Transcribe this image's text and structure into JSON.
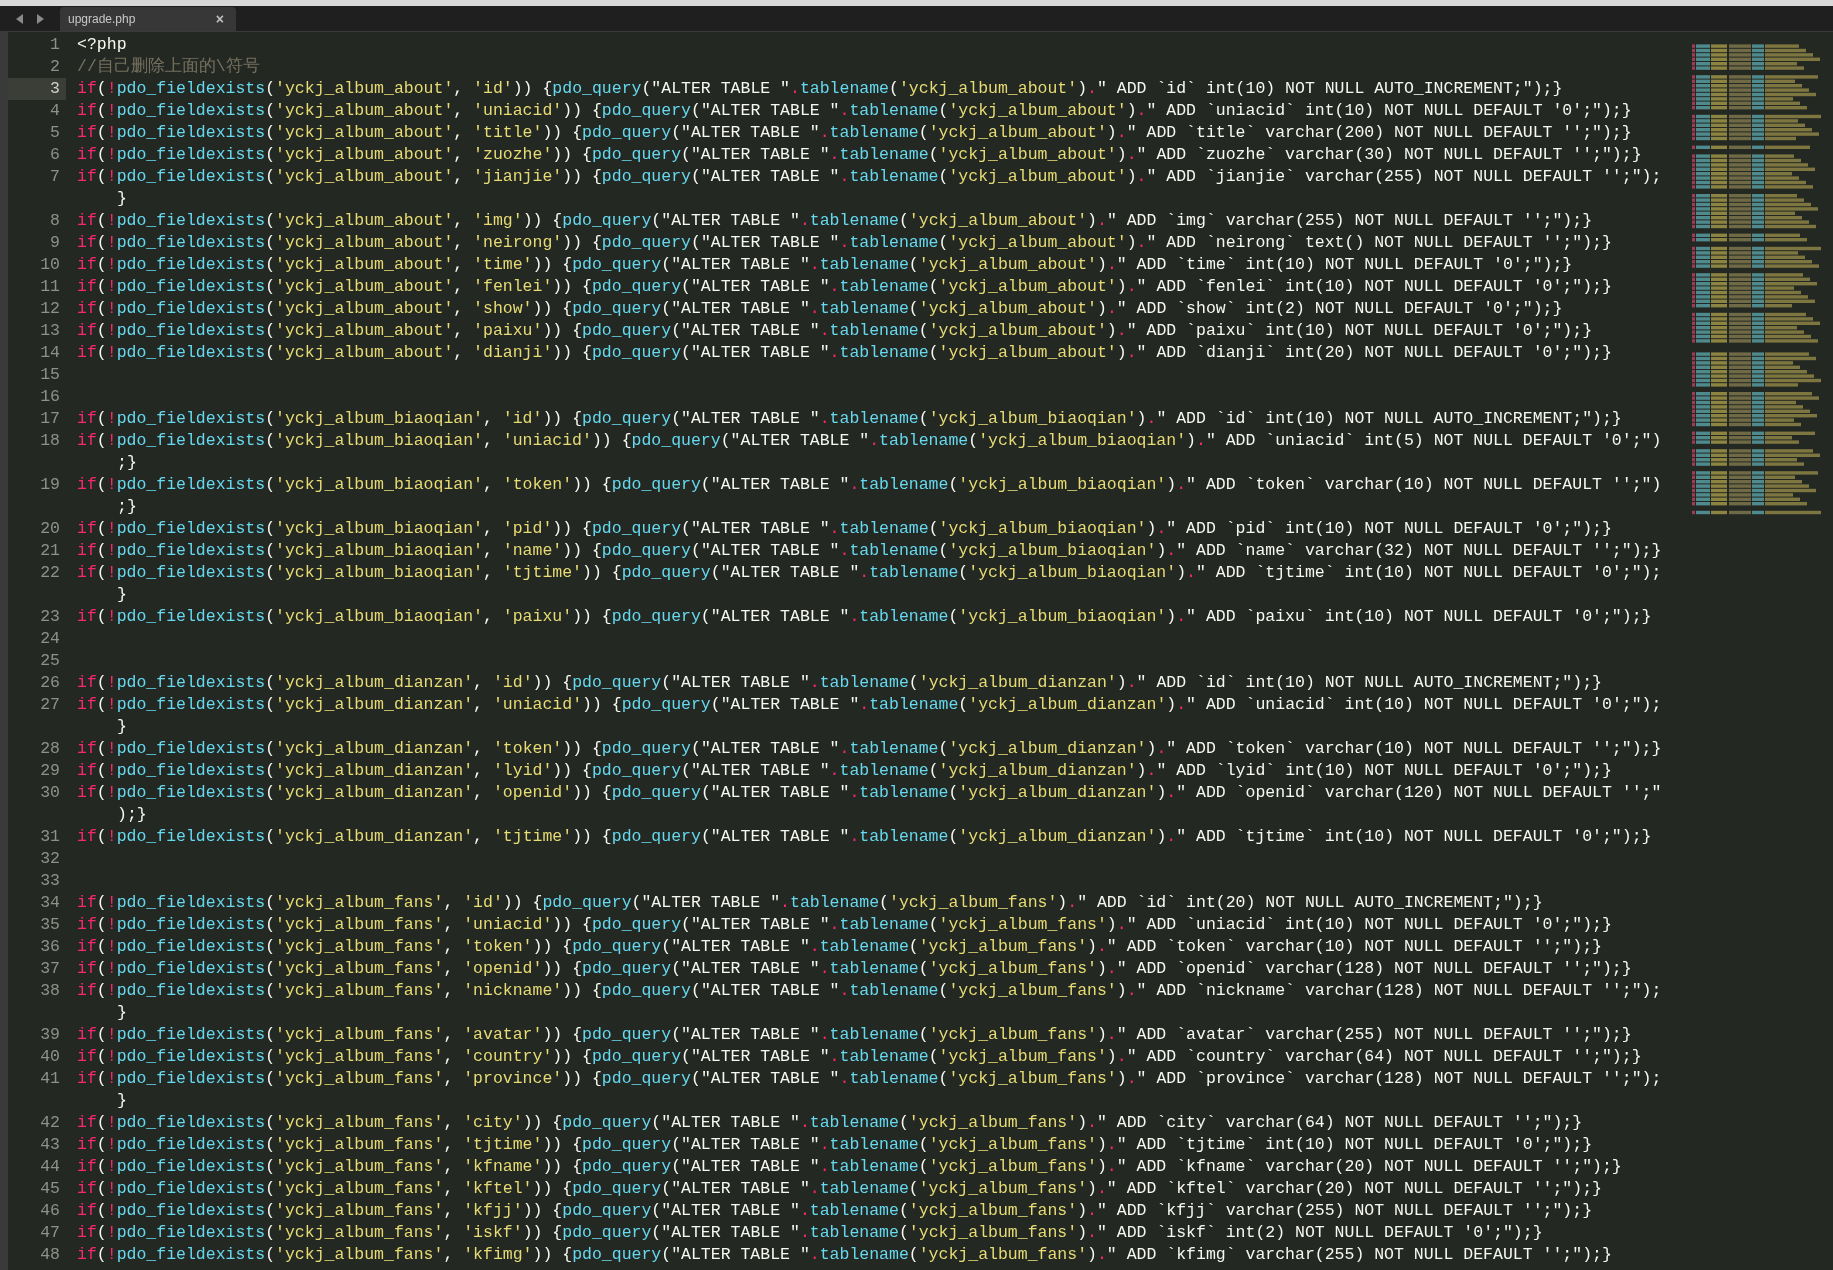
{
  "tab": {
    "title": "upgrade.php",
    "close": "×",
    "selected": true
  },
  "lines": [
    {
      "number": "1",
      "text": "<?php",
      "current": false
    },
    {
      "number": "2",
      "text": "//自己删除上面的\\符号",
      "current": false
    },
    {
      "number": "3",
      "text": "if(!pdo_fieldexists('yckj_album_about', 'id')) {pdo_query(\"ALTER TABLE \".tablename('yckj_album_about').\" ADD `id` int(10) NOT NULL AUTO_INCREMENT;\");}",
      "current": true
    },
    {
      "number": "4",
      "text": "if(!pdo_fieldexists('yckj_album_about', 'uniacid')) {pdo_query(\"ALTER TABLE \".tablename('yckj_album_about').\" ADD `uniacid` int(10) NOT NULL DEFAULT '0';\");}",
      "current": false
    },
    {
      "number": "5",
      "text": "if(!pdo_fieldexists('yckj_album_about', 'title')) {pdo_query(\"ALTER TABLE \".tablename('yckj_album_about').\" ADD `title` varchar(200) NOT NULL DEFAULT '';\");}",
      "current": false
    },
    {
      "number": "6",
      "text": "if(!pdo_fieldexists('yckj_album_about', 'zuozhe')) {pdo_query(\"ALTER TABLE \".tablename('yckj_album_about').\" ADD `zuozhe` varchar(30) NOT NULL DEFAULT '';\");}",
      "current": false
    },
    {
      "number": "7",
      "text": "if(!pdo_fieldexists('yckj_album_about', 'jianjie')) {pdo_query(\"ALTER TABLE \".tablename('yckj_album_about').\" ADD `jianjie` varchar(255) NOT NULL DEFAULT '';\");",
      "wrap": "}",
      "current": false
    },
    {
      "number": "8",
      "text": "if(!pdo_fieldexists('yckj_album_about', 'img')) {pdo_query(\"ALTER TABLE \".tablename('yckj_album_about').\" ADD `img` varchar(255) NOT NULL DEFAULT '';\");}",
      "current": false
    },
    {
      "number": "9",
      "text": "if(!pdo_fieldexists('yckj_album_about', 'neirong')) {pdo_query(\"ALTER TABLE \".tablename('yckj_album_about').\" ADD `neirong` text() NOT NULL DEFAULT '';\");}",
      "current": false
    },
    {
      "number": "10",
      "text": "if(!pdo_fieldexists('yckj_album_about', 'time')) {pdo_query(\"ALTER TABLE \".tablename('yckj_album_about').\" ADD `time` int(10) NOT NULL DEFAULT '0';\");}",
      "current": false
    },
    {
      "number": "11",
      "text": "if(!pdo_fieldexists('yckj_album_about', 'fenlei')) {pdo_query(\"ALTER TABLE \".tablename('yckj_album_about').\" ADD `fenlei` int(10) NOT NULL DEFAULT '0';\");}",
      "current": false
    },
    {
      "number": "12",
      "text": "if(!pdo_fieldexists('yckj_album_about', 'show')) {pdo_query(\"ALTER TABLE \".tablename('yckj_album_about').\" ADD `show` int(2) NOT NULL DEFAULT '0';\");}",
      "current": false
    },
    {
      "number": "13",
      "text": "if(!pdo_fieldexists('yckj_album_about', 'paixu')) {pdo_query(\"ALTER TABLE \".tablename('yckj_album_about').\" ADD `paixu` int(10) NOT NULL DEFAULT '0';\");}",
      "current": false
    },
    {
      "number": "14",
      "text": "if(!pdo_fieldexists('yckj_album_about', 'dianji')) {pdo_query(\"ALTER TABLE \".tablename('yckj_album_about').\" ADD `dianji` int(20) NOT NULL DEFAULT '0';\");}",
      "current": false
    },
    {
      "number": "15",
      "current": false
    },
    {
      "number": "16",
      "current": false
    },
    {
      "number": "17",
      "text": "if(!pdo_fieldexists('yckj_album_biaoqian', 'id')) {pdo_query(\"ALTER TABLE \".tablename('yckj_album_biaoqian').\" ADD `id` int(10) NOT NULL AUTO_INCREMENT;\");}",
      "current": false
    },
    {
      "number": "18",
      "text": "if(!pdo_fieldexists('yckj_album_biaoqian', 'uniacid')) {pdo_query(\"ALTER TABLE \".tablename('yckj_album_biaoqian').\" ADD `uniacid` int(5) NOT NULL DEFAULT '0';\")",
      "wrap": ";}",
      "current": false
    },
    {
      "number": "19",
      "text": "if(!pdo_fieldexists('yckj_album_biaoqian', 'token')) {pdo_query(\"ALTER TABLE \".tablename('yckj_album_biaoqian').\" ADD `token` varchar(10) NOT NULL DEFAULT '';\")",
      "wrap": ";}",
      "current": false
    },
    {
      "number": "20",
      "text": "if(!pdo_fieldexists('yckj_album_biaoqian', 'pid')) {pdo_query(\"ALTER TABLE \".tablename('yckj_album_biaoqian').\" ADD `pid` int(10) NOT NULL DEFAULT '0';\");}",
      "current": false
    },
    {
      "number": "21",
      "text": "if(!pdo_fieldexists('yckj_album_biaoqian', 'name')) {pdo_query(\"ALTER TABLE \".tablename('yckj_album_biaoqian').\" ADD `name` varchar(32) NOT NULL DEFAULT '';\");}",
      "current": false
    },
    {
      "number": "22",
      "text": "if(!pdo_fieldexists('yckj_album_biaoqian', 'tjtime')) {pdo_query(\"ALTER TABLE \".tablename('yckj_album_biaoqian').\" ADD `tjtime` int(10) NOT NULL DEFAULT '0';\");",
      "wrap": "}",
      "current": false
    },
    {
      "number": "23",
      "text": "if(!pdo_fieldexists('yckj_album_biaoqian', 'paixu')) {pdo_query(\"ALTER TABLE \".tablename('yckj_album_biaoqian').\" ADD `paixu` int(10) NOT NULL DEFAULT '0';\");}",
      "current": false
    },
    {
      "number": "24",
      "current": false
    },
    {
      "number": "25",
      "current": false
    },
    {
      "number": "26",
      "text": "if(!pdo_fieldexists('yckj_album_dianzan', 'id')) {pdo_query(\"ALTER TABLE \".tablename('yckj_album_dianzan').\" ADD `id` int(10) NOT NULL AUTO_INCREMENT;\");}",
      "current": false
    },
    {
      "number": "27",
      "text": "if(!pdo_fieldexists('yckj_album_dianzan', 'uniacid')) {pdo_query(\"ALTER TABLE \".tablename('yckj_album_dianzan').\" ADD `uniacid` int(10) NOT NULL DEFAULT '0';\");",
      "wrap": "}",
      "current": false
    },
    {
      "number": "28",
      "text": "if(!pdo_fieldexists('yckj_album_dianzan', 'token')) {pdo_query(\"ALTER TABLE \".tablename('yckj_album_dianzan').\" ADD `token` varchar(10) NOT NULL DEFAULT '';\");}",
      "current": false
    },
    {
      "number": "29",
      "text": "if(!pdo_fieldexists('yckj_album_dianzan', 'lyid')) {pdo_query(\"ALTER TABLE \".tablename('yckj_album_dianzan').\" ADD `lyid` int(10) NOT NULL DEFAULT '0';\");}",
      "current": false
    },
    {
      "number": "30",
      "text": "if(!pdo_fieldexists('yckj_album_dianzan', 'openid')) {pdo_query(\"ALTER TABLE \".tablename('yckj_album_dianzan').\" ADD `openid` varchar(120) NOT NULL DEFAULT '';\"",
      "wrap": ");}",
      "current": false
    },
    {
      "number": "31",
      "text": "if(!pdo_fieldexists('yckj_album_dianzan', 'tjtime')) {pdo_query(\"ALTER TABLE \".tablename('yckj_album_dianzan').\" ADD `tjtime` int(10) NOT NULL DEFAULT '0';\");}",
      "current": false
    },
    {
      "number": "32",
      "current": false
    },
    {
      "number": "33",
      "current": false
    },
    {
      "number": "34",
      "text": "if(!pdo_fieldexists('yckj_album_fans', 'id')) {pdo_query(\"ALTER TABLE \".tablename('yckj_album_fans').\" ADD `id` int(20) NOT NULL AUTO_INCREMENT;\");}",
      "current": false
    },
    {
      "number": "35",
      "text": "if(!pdo_fieldexists('yckj_album_fans', 'uniacid')) {pdo_query(\"ALTER TABLE \".tablename('yckj_album_fans').\" ADD `uniacid` int(10) NOT NULL DEFAULT '0';\");}",
      "current": false
    },
    {
      "number": "36",
      "text": "if(!pdo_fieldexists('yckj_album_fans', 'token')) {pdo_query(\"ALTER TABLE \".tablename('yckj_album_fans').\" ADD `token` varchar(10) NOT NULL DEFAULT '';\");}",
      "current": false
    },
    {
      "number": "37",
      "text": "if(!pdo_fieldexists('yckj_album_fans', 'openid')) {pdo_query(\"ALTER TABLE \".tablename('yckj_album_fans').\" ADD `openid` varchar(128) NOT NULL DEFAULT '';\");}",
      "current": false
    },
    {
      "number": "38",
      "text": "if(!pdo_fieldexists('yckj_album_fans', 'nickname')) {pdo_query(\"ALTER TABLE \".tablename('yckj_album_fans').\" ADD `nickname` varchar(128) NOT NULL DEFAULT '';\");",
      "wrap": "}",
      "current": false
    },
    {
      "number": "39",
      "text": "if(!pdo_fieldexists('yckj_album_fans', 'avatar')) {pdo_query(\"ALTER TABLE \".tablename('yckj_album_fans').\" ADD `avatar` varchar(255) NOT NULL DEFAULT '';\");}",
      "current": false
    },
    {
      "number": "40",
      "text": "if(!pdo_fieldexists('yckj_album_fans', 'country')) {pdo_query(\"ALTER TABLE \".tablename('yckj_album_fans').\" ADD `country` varchar(64) NOT NULL DEFAULT '';\");}",
      "current": false
    },
    {
      "number": "41",
      "text": "if(!pdo_fieldexists('yckj_album_fans', 'province')) {pdo_query(\"ALTER TABLE \".tablename('yckj_album_fans').\" ADD `province` varchar(128) NOT NULL DEFAULT '';\");",
      "wrap": "}",
      "current": false
    },
    {
      "number": "42",
      "text": "if(!pdo_fieldexists('yckj_album_fans', 'city')) {pdo_query(\"ALTER TABLE \".tablename('yckj_album_fans').\" ADD `city` varchar(64) NOT NULL DEFAULT '';\");}",
      "current": false
    },
    {
      "number": "43",
      "text": "if(!pdo_fieldexists('yckj_album_fans', 'tjtime')) {pdo_query(\"ALTER TABLE \".tablename('yckj_album_fans').\" ADD `tjtime` int(10) NOT NULL DEFAULT '0';\");}",
      "current": false
    },
    {
      "number": "44",
      "text": "if(!pdo_fieldexists('yckj_album_fans', 'kfname')) {pdo_query(\"ALTER TABLE \".tablename('yckj_album_fans').\" ADD `kfname` varchar(20) NOT NULL DEFAULT '';\");}",
      "current": false
    },
    {
      "number": "45",
      "text": "if(!pdo_fieldexists('yckj_album_fans', 'kftel')) {pdo_query(\"ALTER TABLE \".tablename('yckj_album_fans').\" ADD `kftel` varchar(20) NOT NULL DEFAULT '';\");}",
      "current": false
    },
    {
      "number": "46",
      "text": "if(!pdo_fieldexists('yckj_album_fans', 'kfjj')) {pdo_query(\"ALTER TABLE \".tablename('yckj_album_fans').\" ADD `kfjj` varchar(255) NOT NULL DEFAULT '';\");}",
      "current": false
    },
    {
      "number": "47",
      "text": "if(!pdo_fieldexists('yckj_album_fans', 'iskf')) {pdo_query(\"ALTER TABLE \".tablename('yckj_album_fans').\" ADD `iskf` int(2) NOT NULL DEFAULT '0';\");}",
      "current": false
    },
    {
      "number": "48",
      "text": "if(!pdo_fieldexists('yckj_album_fans', 'kfimg')) {pdo_query(\"ALTER TABLE \".tablename('yckj_album_fans').\" ADD `kfimg` varchar(255) NOT NULL DEFAULT '';\");}",
      "current": false
    }
  ]
}
